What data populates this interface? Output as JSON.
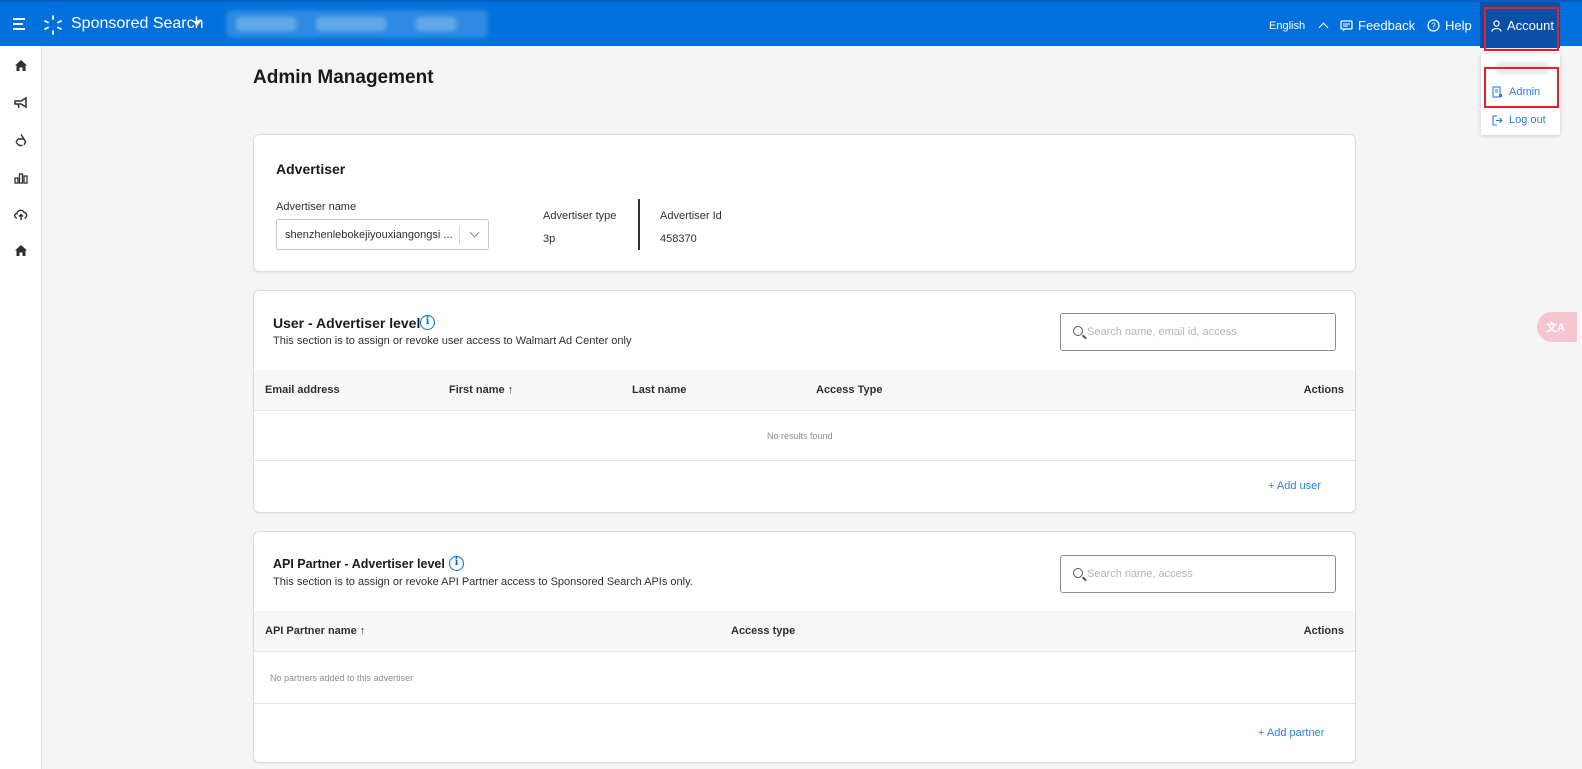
{
  "topbar": {
    "brand": "Sponsored Search",
    "language": "English",
    "feedback": "Feedback",
    "help": "Help",
    "account": "Account"
  },
  "page": {
    "title": "Admin Management"
  },
  "advertiser": {
    "heading": "Advertiser",
    "name_label": "Advertiser name",
    "name_value": "shenzhenlebokejiyouxiangongsi ...",
    "type_label": "Advertiser type",
    "type_value": "3p",
    "id_label": "Advertiser Id",
    "id_value": "458370"
  },
  "user_section": {
    "heading": "User - Advertiser level",
    "description": "This section is to assign or revoke user access to Walmart Ad Center only",
    "search_placeholder": "Search name, email id, access",
    "columns": [
      "Email address",
      "First name ↑",
      "Last name",
      "Access Type",
      "Actions"
    ],
    "empty_text": "No results found",
    "add_link": "+ Add user"
  },
  "api_section": {
    "heading": "API Partner - Advertiser level",
    "description": "This section is to assign or revoke API Partner access to Sponsored Search APIs only.",
    "search_placeholder": "Search name, access",
    "columns": [
      "API Partner name ↑",
      "Access type",
      "Actions"
    ],
    "empty_text": "No partners added to this advertiser",
    "add_link": "+ Add partner"
  },
  "account_menu": {
    "items": [
      {
        "label": "Admin",
        "icon": "admin-doc-icon"
      },
      {
        "label": "Log out",
        "icon": "logout-icon"
      }
    ]
  },
  "sidebar": {
    "icons": [
      "home-icon",
      "megaphone-icon",
      "recycle-icon",
      "bar-chart-icon",
      "cloud-upload-icon",
      "home-icon"
    ]
  },
  "colors": {
    "topbar": "#0071dc",
    "link": "#2a7de1",
    "highlight": "#e4202a"
  }
}
